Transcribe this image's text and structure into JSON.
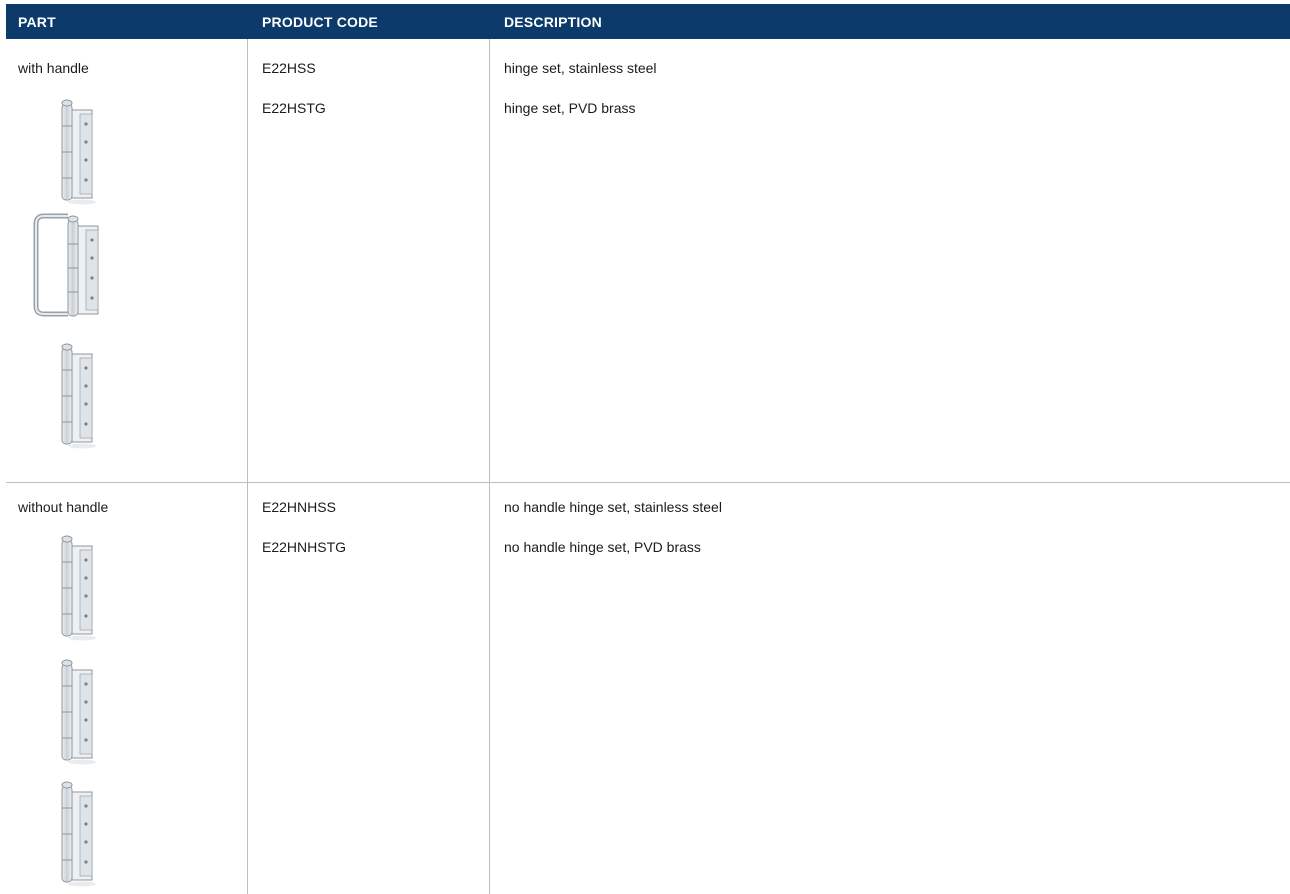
{
  "header": {
    "part": "PART",
    "product_code": "PRODUCT CODE",
    "description": "DESCRIPTION"
  },
  "rows": [
    {
      "part": "with handle",
      "items": [
        {
          "code": "E22HSS",
          "description": "hinge set, stainless steel"
        },
        {
          "code": "E22HSTG",
          "description": "hinge set, PVD brass"
        }
      ],
      "images": [
        "hinge-icon",
        "handle-hinge-icon",
        "hinge-icon"
      ]
    },
    {
      "part": "without handle",
      "items": [
        {
          "code": "E22HNHSS",
          "description": "no handle hinge set, stainless steel"
        },
        {
          "code": "E22HNHSTG",
          "description": "no handle hinge set, PVD brass"
        }
      ],
      "images": [
        "hinge-icon",
        "hinge-icon",
        "hinge-icon"
      ]
    }
  ],
  "colors": {
    "header_bg": "#0b3a6b",
    "header_text": "#ffffff",
    "rule": "#bdbdbd"
  }
}
